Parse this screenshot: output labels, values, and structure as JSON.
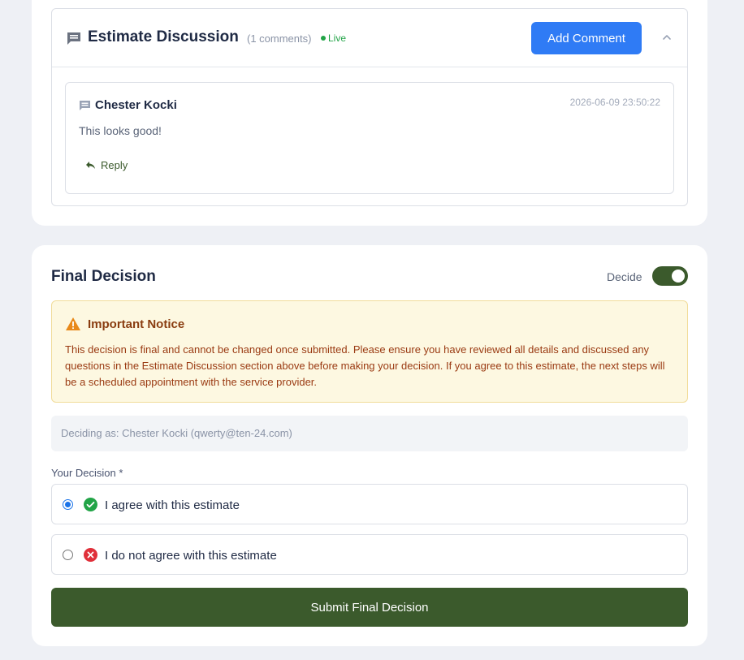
{
  "discussion": {
    "title": "Estimate Discussion",
    "count_label": "(1 comments)",
    "live_label": "Live",
    "add_comment_label": "Add Comment",
    "comments": [
      {
        "author": "Chester Kocki",
        "timestamp": "2026-06-09 23:50:22",
        "text": "This looks good!",
        "reply_label": "Reply"
      }
    ]
  },
  "decision": {
    "title": "Final Decision",
    "decide_label": "Decide",
    "toggle_on": true,
    "notice": {
      "title": "Important Notice",
      "body": "This decision is final and cannot be changed once submitted. Please ensure you have reviewed all details and discussed any questions in the Estimate Discussion section above before making your decision. If you agree to this estimate, the next steps will be a scheduled appointment with the service provider."
    },
    "deciding_as_label": "Deciding as:",
    "deciding_as_value": "Chester Kocki (qwerty@ten-24.com)",
    "your_decision_label": "Your Decision *",
    "options": [
      {
        "label": "I agree with this estimate",
        "selected": true,
        "icon": "check-circle-icon"
      },
      {
        "label": "I do not agree with this estimate",
        "selected": false,
        "icon": "x-circle-icon"
      }
    ],
    "submit_label": "Submit Final Decision"
  },
  "colors": {
    "primary_blue": "#2f7bf5",
    "brand_green": "#3b5a2c",
    "live_green": "#22a447",
    "notice_bg": "#fdf8e1",
    "notice_text": "#9a3a12",
    "error_red": "#e0303a"
  }
}
